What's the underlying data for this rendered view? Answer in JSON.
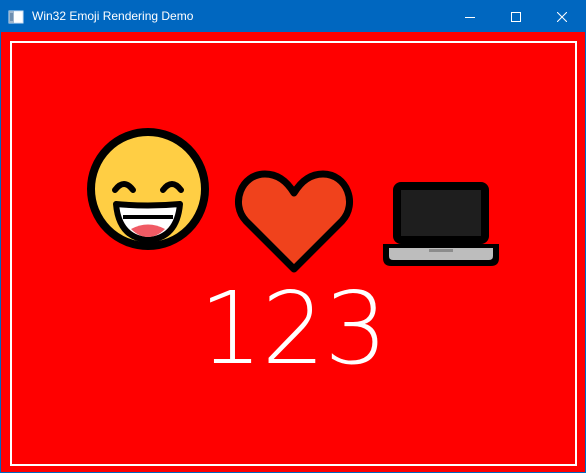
{
  "window": {
    "title": "Win32 Emoji Rendering Demo",
    "titlebar_color": "#0067c0",
    "background_color": "#FF0000",
    "border_color": "#FFFFFF"
  },
  "controls": {
    "minimize_icon": "minimize-icon",
    "maximize_icon": "maximize-icon",
    "close_icon": "close-icon"
  },
  "content": {
    "emojis": [
      {
        "name": "grinning-face-with-smiling-eyes",
        "glyph": "😄"
      },
      {
        "name": "red-heart",
        "glyph": "❤"
      },
      {
        "name": "laptop",
        "glyph": "💻"
      }
    ],
    "number": "123",
    "text_color": "#FFFFFF"
  }
}
